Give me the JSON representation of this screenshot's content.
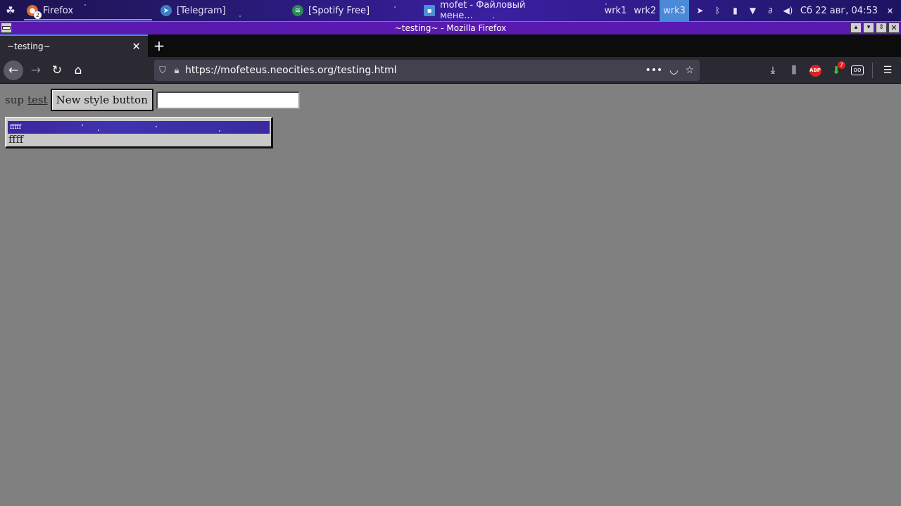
{
  "taskbar": {
    "tasks": [
      {
        "label": "Firefox",
        "badge": "2",
        "active": true
      },
      {
        "label": "[Telegram]"
      },
      {
        "label": "[Spotify Free]"
      },
      {
        "label": "mofet - Файловый мене..."
      }
    ],
    "workspaces": [
      "wrk1",
      "wrk2",
      "wrk3"
    ],
    "active_workspace": "wrk3",
    "clock": "Сб 22 авг, 04:53",
    "tray_icons": [
      "telegram-icon",
      "bluetooth-icon",
      "battery-icon",
      "wifi-icon",
      "link-icon",
      "volume-icon",
      "antenna-icon"
    ]
  },
  "window": {
    "title": "~testing~ - Mozilla Firefox"
  },
  "browser": {
    "tab_title": "~testing~",
    "url": "https://mofeteus.neocities.org/testing.html",
    "download_badge": "7"
  },
  "page": {
    "sup_text": "sup",
    "link_text": "test",
    "button_label": "New style button",
    "input_value": "",
    "listbox_options": [
      "fffff",
      "ffff"
    ],
    "listbox_selected": "fffff"
  },
  "colors": {
    "page_bg": "#808080",
    "titlebar": "#5a1ab0",
    "selection": "#3b2fa8",
    "active_workspace": "#4a8ad8"
  }
}
